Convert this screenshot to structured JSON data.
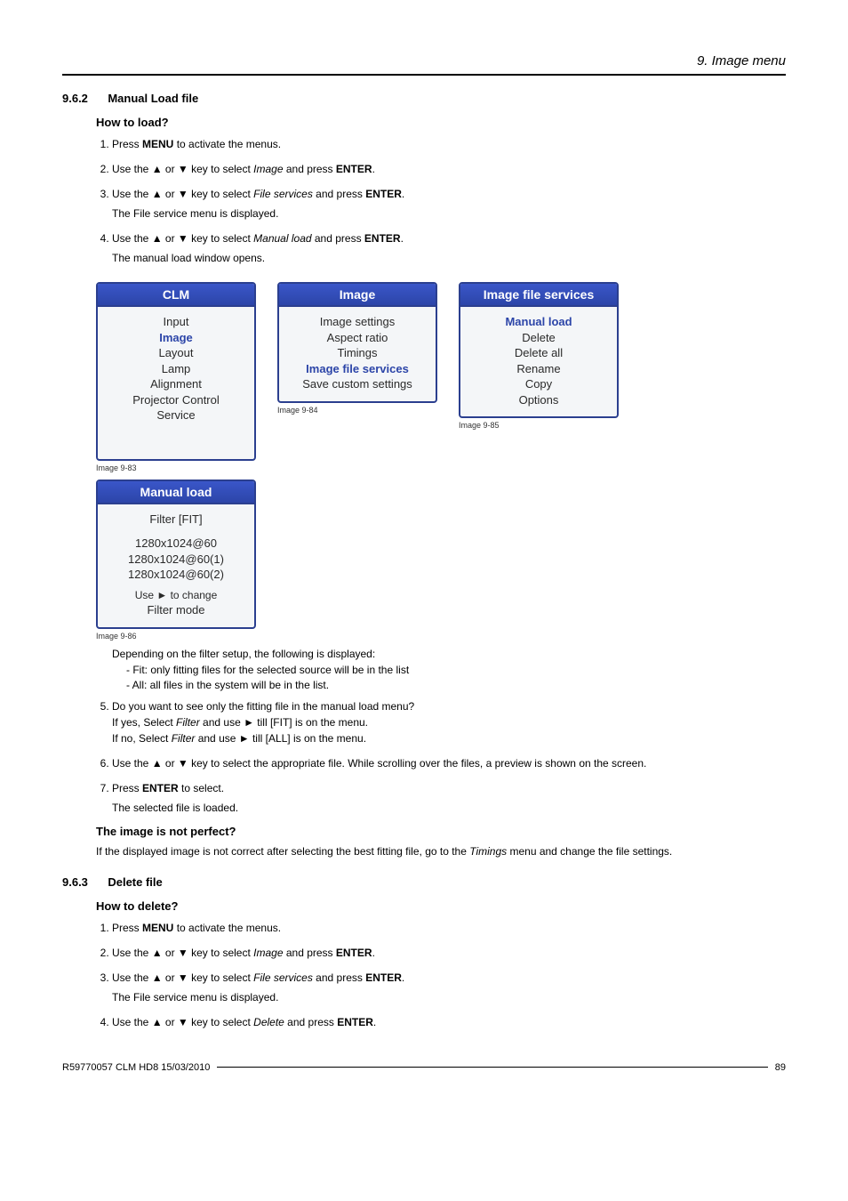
{
  "chapter": "9. Image menu",
  "sec1": {
    "num": "9.6.2",
    "title": "Manual Load file"
  },
  "sub1": "How to load?",
  "steps1": {
    "s1a": "Press ",
    "s1b": "MENU",
    "s1c": " to activate the menus.",
    "s2a": "Use the ▲ or ▼ key to select ",
    "s2b": "Image",
    "s2c": " and press ",
    "s2d": "ENTER",
    "s2e": ".",
    "s3a": "Use the ▲ or ▼ key to select ",
    "s3b": "File services",
    "s3c": " and press ",
    "s3d": "ENTER",
    "s3e": ".",
    "s3f": "The File service menu is displayed.",
    "s4a": "Use the ▲ or ▼ key to select ",
    "s4b": "Manual load",
    "s4c": " and press ",
    "s4d": "ENTER",
    "s4e": ".",
    "s4f": "The manual load window opens."
  },
  "panel1": {
    "title": "CLM",
    "i1": "Input",
    "i2": "Image",
    "i3": "Layout",
    "i4": "Lamp",
    "i5": "Alignment",
    "i6": "Projector Control",
    "i7": "Service",
    "cap": "Image 9-83"
  },
  "panel2": {
    "title": "Image",
    "i1": "Image settings",
    "i2": "Aspect ratio",
    "i3": "Timings",
    "i4": "Image file services",
    "i5": "Save custom settings",
    "cap": "Image 9-84"
  },
  "panel3": {
    "title": "Image file services",
    "i1": "Manual load",
    "i2": "Delete",
    "i3": "Delete all",
    "i4": "Rename",
    "i5": "Copy",
    "i6": "Options",
    "cap": "Image 9-85"
  },
  "panel4": {
    "title": "Manual load",
    "filter": "Filter [FIT]",
    "f1": "1280x1024@60",
    "f2": "1280x1024@60(1)",
    "f3": "1280x1024@60(2)",
    "hint1": "Use ► to change",
    "hint2": "Filter mode",
    "cap": "Image 9-86"
  },
  "after4": {
    "lead": "Depending on the filter setup, the following is displayed:",
    "d1": "Fit: only fitting files for the selected source will be in the list",
    "d2": "All: all files in the system will be in the list."
  },
  "step5": {
    "q": "Do you want to see only the fitting file in the manual load menu?",
    "y1": "If yes, Select ",
    "y2": "Filter",
    "y3": " and use ► till [FIT] is on the menu.",
    "n1": "If no, Select ",
    "n2": "Filter",
    "n3": " and use ► till [ALL] is on the menu."
  },
  "step6": "Use the ▲ or ▼ key to select the appropriate file. While scrolling over the files, a preview is shown on the screen.",
  "step7a": "Press ",
  "step7b": "ENTER",
  "step7c": " to select.",
  "step7sub": "The selected file is loaded.",
  "sub2": "The image is not perfect?",
  "sub2p1": "If the displayed image is not correct after selecting the best fitting file, go to the ",
  "sub2p2": "Timings",
  "sub2p3": " menu and change the file settings.",
  "sec2": {
    "num": "9.6.3",
    "title": "Delete file"
  },
  "sub3": "How to delete?",
  "steps2": {
    "s1a": "Press ",
    "s1b": "MENU",
    "s1c": " to activate the menus.",
    "s2a": "Use the ▲ or ▼ key to select ",
    "s2b": "Image",
    "s2c": " and press ",
    "s2d": "ENTER",
    "s2e": ".",
    "s3a": "Use the ▲ or ▼ key to select ",
    "s3b": "File services",
    "s3c": " and press ",
    "s3d": "ENTER",
    "s3e": ".",
    "s3f": "The File service menu is displayed.",
    "s4a": "Use the ▲ or ▼ key to select ",
    "s4b": "Delete",
    "s4c": " and press ",
    "s4d": "ENTER",
    "s4e": "."
  },
  "footer": {
    "left": "R59770057  CLM HD8  15/03/2010",
    "right": "89"
  }
}
